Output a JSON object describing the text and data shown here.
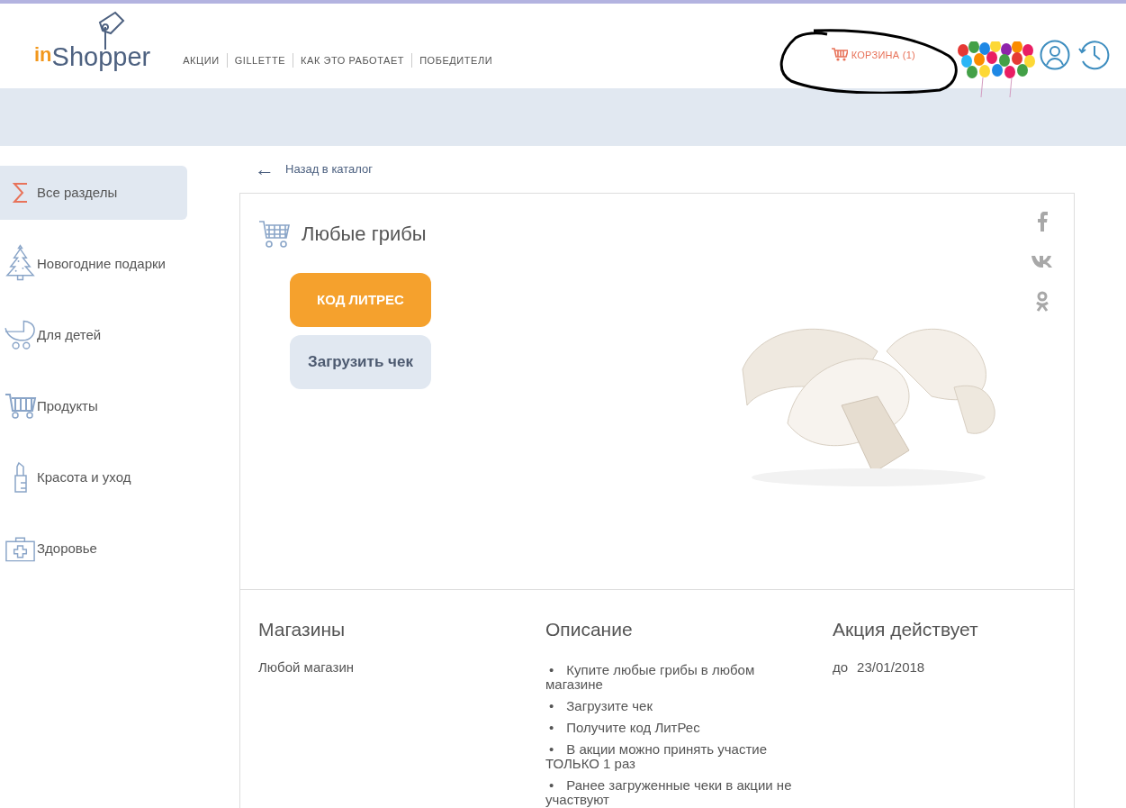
{
  "header": {
    "logo": {
      "prefix": "in",
      "name": "Shopper"
    },
    "nav": [
      "АКЦИИ",
      "GILLETTE",
      "КАК ЭТО РАБОТАЕТ",
      "ПОБЕДИТЕЛИ"
    ],
    "cart": "КОРЗИНА (1)"
  },
  "sidebar": {
    "items": [
      {
        "kind": "sigma",
        "label": "Все разделы",
        "selected": true
      },
      {
        "kind": "tree",
        "label": "Новогодние подарки",
        "selected": false
      },
      {
        "kind": "stroller",
        "label": "Для детей",
        "selected": false
      },
      {
        "kind": "cart",
        "label": "Продукты",
        "selected": false
      },
      {
        "kind": "lipstick",
        "label": "Красота и уход",
        "selected": false
      },
      {
        "kind": "medkit",
        "label": "Здоровье",
        "selected": false
      }
    ]
  },
  "back_link": {
    "arrow": "←",
    "label": "Назад в каталог"
  },
  "offer": {
    "title": "Любые грибы",
    "primary_button": "КОД ЛИТРЕС",
    "secondary_button": "Загрузить чек"
  },
  "details": {
    "stores": {
      "title": "Магазины",
      "text": "Любой магазин"
    },
    "description": {
      "title": "Описание",
      "items": [
        {
          "marker": "•",
          "text": "Купите любые грибы в любом магазине"
        },
        {
          "marker": "•",
          "text": "Загрузите чек"
        },
        {
          "marker": "•",
          "text": "Получите код ЛитРес"
        },
        {
          "marker": "•",
          "text": "В акции можно принять участие ТОЛЬКО 1 раз"
        },
        {
          "marker": "•",
          "text": "Ранее загруженные чеки в акции не участвуют"
        }
      ]
    },
    "validity": {
      "title": "Акция действует",
      "prefix": "до",
      "date": "23/01/2018"
    }
  }
}
